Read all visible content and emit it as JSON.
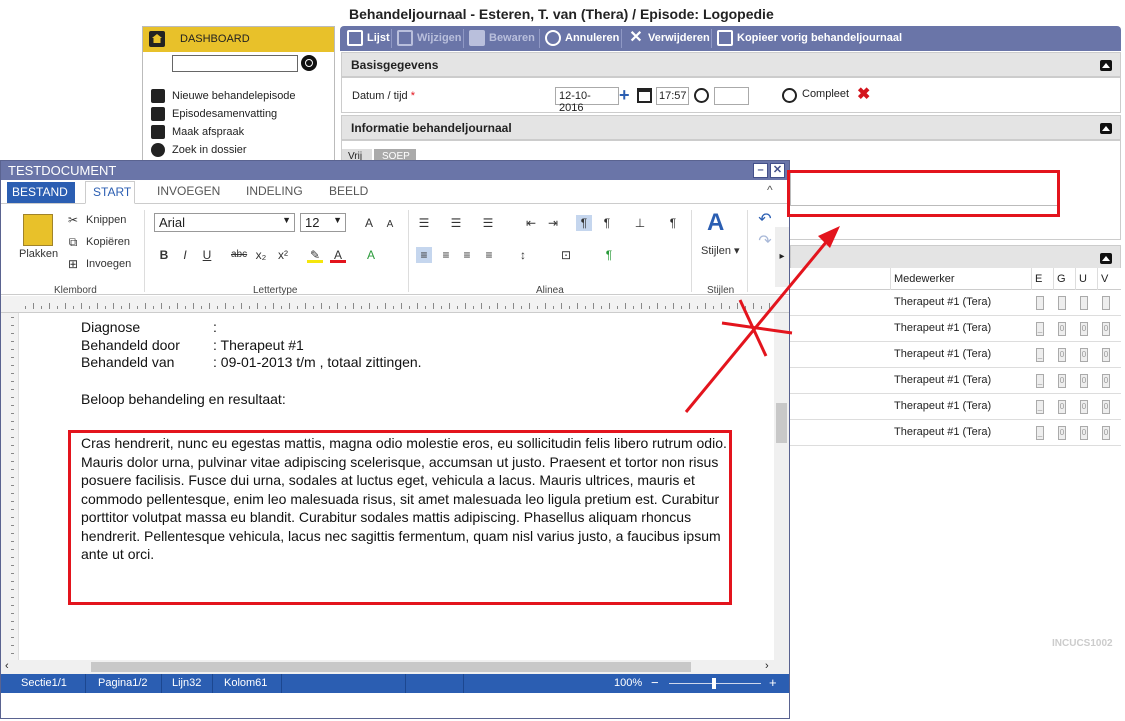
{
  "header": {
    "title": "Behandeljournaal - Esteren, T. van (Thera) / Episode: Logopedie"
  },
  "leftpanel": {
    "dashboard_label": "DASHBOARD",
    "items": [
      {
        "label": "Nieuwe behandelepisode",
        "icon": "calendar-icon"
      },
      {
        "label": "Episodesamenvatting",
        "icon": "document-list-icon"
      },
      {
        "label": "Maak afspraak",
        "icon": "calendar-grid-icon"
      },
      {
        "label": "Zoek in dossier",
        "icon": "search-icon"
      }
    ]
  },
  "toolbar": {
    "lijst": "Lijst",
    "wijzigen": "Wijzigen",
    "bewaren": "Bewaren",
    "annuleren": "Annuleren",
    "verwijderen": "Verwijderen",
    "kopieer": "Kopieer vorig behandeljournaal"
  },
  "basis": {
    "title": "Basisgegevens",
    "datum_label": "Datum / tijd",
    "required_mark": "*",
    "date": "12-10-2016",
    "time": "17:57",
    "compleet": "Compleet"
  },
  "info": {
    "title": "Informatie behandeljournaal",
    "tab1": "Vrij",
    "tab2": "SOEP"
  },
  "table": {
    "header_medewerker": "Medewerker",
    "cols": [
      "E",
      "G",
      "U",
      "V"
    ],
    "rows": [
      {
        "medewerker": "Therapeut #1 (Tera)",
        "checks": [
          "",
          "",
          "",
          ""
        ]
      },
      {
        "medewerker": "Therapeut #1 (Tera)",
        "checks": [
          "_",
          "0",
          "0",
          "0"
        ]
      },
      {
        "medewerker": "Therapeut #1 (Tera)",
        "checks": [
          "_",
          "0",
          "0",
          "0"
        ]
      },
      {
        "medewerker": "Therapeut #1 (Tera)",
        "checks": [
          "_",
          "0",
          "0",
          "0"
        ]
      },
      {
        "medewerker": "Therapeut #1 (Tera)",
        "checks": [
          "_",
          "0",
          "0",
          "0"
        ]
      },
      {
        "medewerker": "Therapeut #1 (Tera)",
        "checks": [
          "_",
          "0",
          "0",
          "0"
        ]
      }
    ],
    "watermark": "INCUCS1002"
  },
  "doc": {
    "title": "TESTDOCUMENT",
    "tabs": [
      "BESTAND",
      "START",
      "INVOEGEN",
      "INDELING",
      "BEELD"
    ],
    "ribbon": {
      "plakken": "Plakken",
      "knippen": "Knippen",
      "kopieren": "Kopiëren",
      "invoegen": "Invoegen",
      "klembord": "Klembord",
      "font": "Arial",
      "size": "12",
      "lettertype": "Lettertype",
      "alinea": "Alinea",
      "stijlen_btn": "Stijlen",
      "stijlen": "Stijlen"
    },
    "lines": {
      "diagnose_label": "Diagnose",
      "diagnose_val": ":",
      "door_label": "Behandeld door",
      "door_val": ": Therapeut #1",
      "van_label": "Behandeld van",
      "van_val": ": 09-01-2013 t/m , totaal zittingen.",
      "beloop": "Beloop behandeling en resultaat:"
    },
    "paragraph": "Cras hendrerit, nunc eu egestas mattis, magna odio molestie eros, eu sollicitudin felis libero rutrum odio. Mauris dolor urna, pulvinar vitae adipiscing scelerisque, accumsan ut justo. Praesent et tortor non risus posuere facilisis. Fusce dui urna, sodales at luctus eget, vehicula a lacus. Mauris ultrices, mauris et commodo pellentesque, enim leo malesuada risus, sit amet malesuada leo ligula pretium est. Curabitur porttitor volutpat massa eu blandit. Curabitur sodales mattis adipiscing. Phasellus aliquam rhoncus hendrerit. Pellentesque vehicula, lacus nec sagittis fermentum, quam nisl varius justo, a faucibus ipsum ante ut orci.",
    "status": {
      "sectie": "Sectie1/1",
      "pagina": "Pagina1/2",
      "lijn": "Lijn32",
      "kolom": "Kolom61",
      "zoom": "100%"
    }
  },
  "colors": {
    "accent": "#6a75a8",
    "dashboard": "#e8c12a",
    "annotation": "#e3141d",
    "statusbar": "#2b5eb2"
  }
}
